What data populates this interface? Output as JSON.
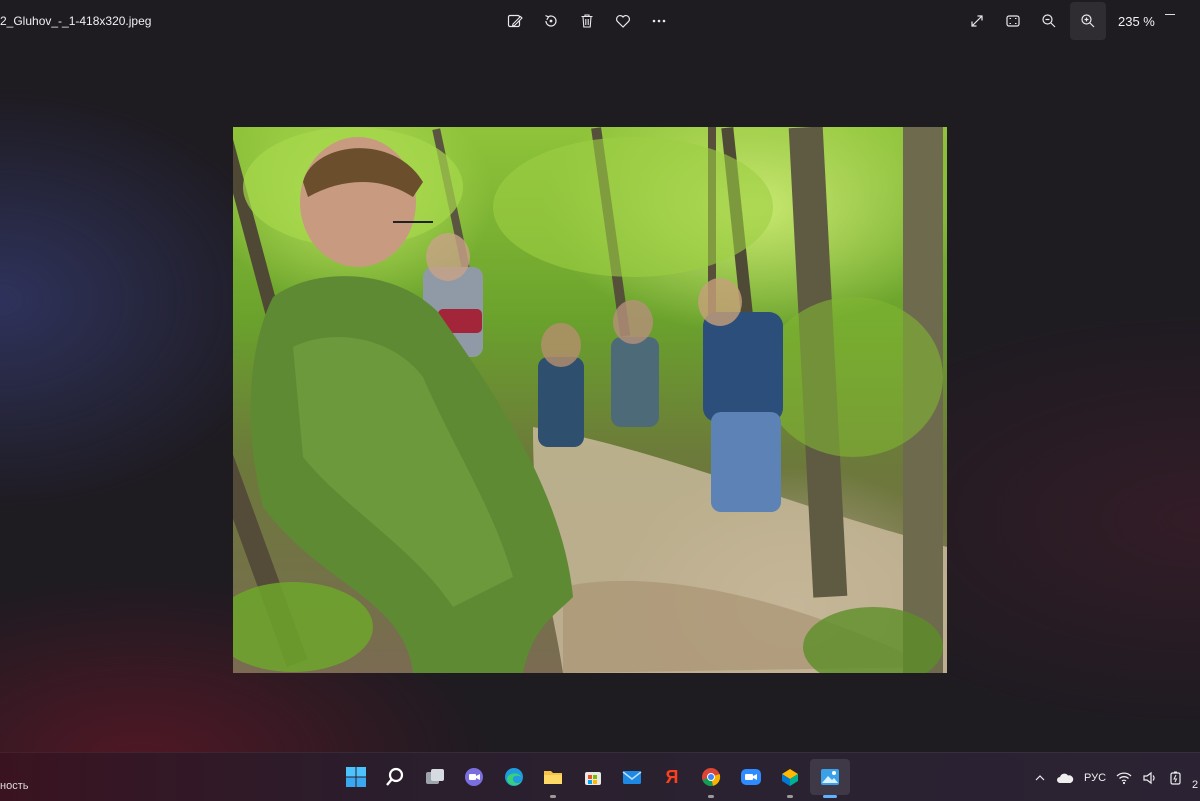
{
  "window": {
    "filename": "2_Gluhov_-_1-418x320.jpeg",
    "zoom_label": "235 %"
  },
  "toolbar": {
    "center": [
      "edit-image-icon",
      "rotate-icon",
      "delete-icon",
      "favorite-icon",
      "more-icon"
    ],
    "right": [
      "fullscreen-icon",
      "fit-window-icon",
      "zoom-out-icon",
      "zoom-in-icon"
    ]
  },
  "photo": {
    "description_icon": "photo-content"
  },
  "taskbar": {
    "left_text": "ность",
    "apps": [
      "start",
      "search",
      "task-view",
      "teams-chat",
      "edge",
      "file-explorer",
      "store",
      "mail",
      "yandex",
      "chrome",
      "zoom",
      "app",
      "photos"
    ],
    "yandex_glyph": "Я",
    "tray_language": "РУС",
    "clock_stub": "2"
  }
}
